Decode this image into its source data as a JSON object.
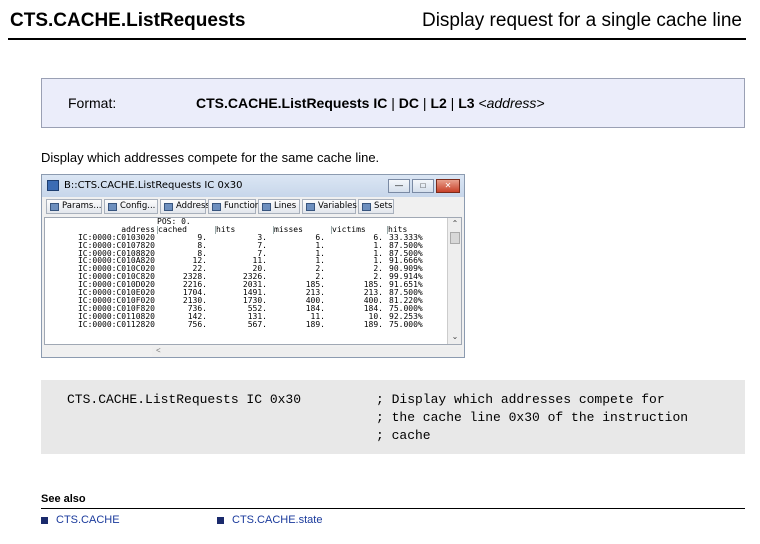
{
  "header": {
    "title": "CTS.CACHE.ListRequests",
    "subtitle": "Display request for a single cache line"
  },
  "format": {
    "label": "Format:",
    "command": "CTS.CACHE.ListRequests IC",
    "sep1": " | ",
    "opt_dc": "DC",
    "sep2": " | ",
    "opt_l2": "L2",
    "sep3": " | ",
    "opt_l3": "L3",
    "arg": " <address>"
  },
  "description": "Display which addresses compete for the same cache line.",
  "window": {
    "title": "B::CTS.CACHE.ListRequests IC 0x30",
    "toolbar": [
      "Params...",
      "Config...",
      "Addresses",
      "Functions",
      "Lines",
      "Variables",
      "Sets"
    ],
    "pos_label": "POS: 0.",
    "columns": [
      "address",
      "cached",
      "hits",
      "misses",
      "victims",
      "hits"
    ],
    "rows": [
      [
        "IC:0000:C0103020",
        "9.",
        "3.",
        "6.",
        "6.",
        "33.333%"
      ],
      [
        "IC:0000:C0107820",
        "8.",
        "7.",
        "1.",
        "1.",
        "87.500%"
      ],
      [
        "IC:0000:C0108820",
        "8.",
        "7.",
        "1.",
        "1.",
        "87.500%"
      ],
      [
        "IC:0000:C010A820",
        "12.",
        "11.",
        "1.",
        "1.",
        "91.666%"
      ],
      [
        "IC:0000:C010C020",
        "22.",
        "20.",
        "2.",
        "2.",
        "90.909%"
      ],
      [
        "IC:0000:C010C820",
        "2328.",
        "2326.",
        "2.",
        "2.",
        "99.914%"
      ],
      [
        "IC:0000:C010D020",
        "2216.",
        "2031.",
        "185.",
        "185.",
        "91.651%"
      ],
      [
        "IC:0000:C010E020",
        "1704.",
        "1491.",
        "213.",
        "213.",
        "87.500%"
      ],
      [
        "IC:0000:C010F020",
        "2130.",
        "1730.",
        "400.",
        "400.",
        "81.220%"
      ],
      [
        "IC:0000:C010F820",
        "736.",
        "552.",
        "184.",
        "184.",
        "75.000%"
      ],
      [
        "IC:0000:C0110820",
        "142.",
        "131.",
        "11.",
        "10.",
        "92.253%"
      ],
      [
        "IC:0000:C0112820",
        "756.",
        "567.",
        "189.",
        "189.",
        "75.000%"
      ]
    ]
  },
  "code": {
    "command": "CTS.CACHE.ListRequests IC 0x30",
    "comments": [
      "; Display which addresses compete for",
      "; the cache line 0x30 of the instruction",
      "; cache"
    ]
  },
  "see_also": {
    "title": "See also",
    "links": [
      "CTS.CACHE",
      "CTS.CACHE.state"
    ]
  }
}
